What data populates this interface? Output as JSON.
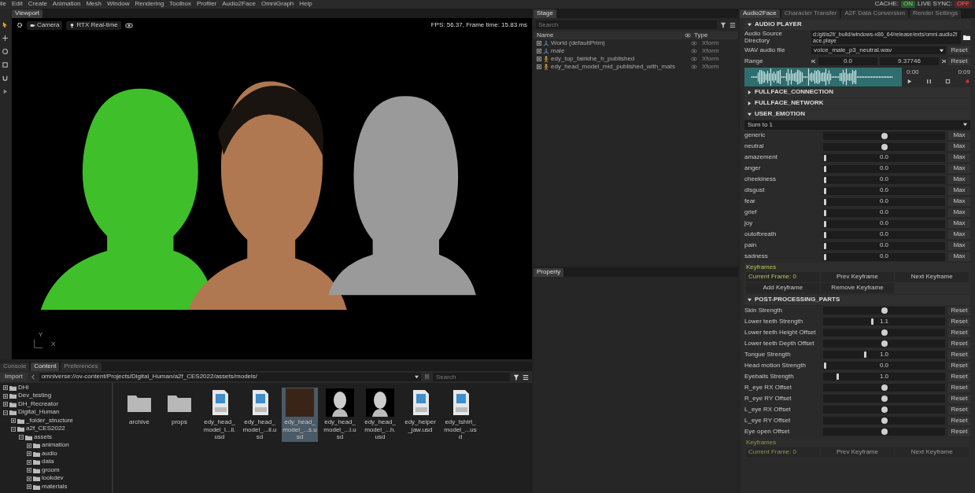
{
  "menu": [
    "ile",
    "Edit",
    "Create",
    "Animation",
    "Mesh",
    "Window",
    "Rendering",
    "Toolbox",
    "Profiler",
    "Audio2Face",
    "OmniGraph",
    "Help"
  ],
  "status": [
    {
      "label": "CACHE:",
      "value": "ON",
      "on": true
    },
    {
      "label": "LIVE SYNC:",
      "value": "OFF",
      "on": false
    }
  ],
  "viewport": {
    "tab": "Viewport",
    "buttons": [
      "Camera",
      "RTX Real-time"
    ],
    "fps": "FPS: 56.37, Frame time: 15.83 ms",
    "axes": [
      "Y",
      "X"
    ]
  },
  "stage": {
    "tab": "Stage",
    "search": {
      "placeholder": "Search"
    },
    "columns": [
      "Name",
      "Type"
    ],
    "rows": [
      {
        "name": "World (defaultPrim)",
        "type": "Xform",
        "kind": "xform"
      },
      {
        "name": "male",
        "type": "Xform",
        "kind": "xform"
      },
      {
        "name": "edy_top_fairkihe_h_published",
        "type": "Xform",
        "kind": "skel"
      },
      {
        "name": "edy_head_model_mid_published_with_mats",
        "type": "Xform",
        "kind": "skel"
      }
    ]
  },
  "property": {
    "tab": "Property"
  },
  "content": {
    "tabs": [
      {
        "label": "Console",
        "selected": false
      },
      {
        "label": "Content",
        "selected": true
      },
      {
        "label": "Preferences",
        "selected": false
      }
    ],
    "import": "Import",
    "path": "omniverse://ov-content/Projects/Digital_Human/a2f_CES2022/assets/models/",
    "search": {
      "placeholder": "Search"
    },
    "tree": [
      {
        "name": "DHI",
        "expanded": false
      },
      {
        "name": "Dev_testing",
        "expanded": false
      },
      {
        "name": "DH_Recreator",
        "expanded": false
      },
      {
        "name": "Digital_Human",
        "expanded": true,
        "children": [
          {
            "name": "_folder_structure",
            "expanded": false
          },
          {
            "name": "a2f_CES2022",
            "expanded": true,
            "children": [
              {
                "name": "assets",
                "expanded": true,
                "children": [
                  {
                    "name": "animation",
                    "expanded": false
                  },
                  {
                    "name": "audio",
                    "expanded": false
                  },
                  {
                    "name": "data",
                    "expanded": false
                  },
                  {
                    "name": "groom",
                    "expanded": false
                  },
                  {
                    "name": "lookdev",
                    "expanded": false
                  },
                  {
                    "name": "materials",
                    "expanded": false
                  }
                ]
              }
            ]
          }
        ]
      }
    ],
    "items": [
      {
        "name": "archive",
        "kind": "folder",
        "selected": false
      },
      {
        "name": "props",
        "kind": "folder",
        "selected": false
      },
      {
        "name": "edy_head_model_l...il.usd",
        "kind": "usd",
        "selected": false
      },
      {
        "name": "edy_head_model_...il.usd",
        "kind": "usd",
        "selected": false
      },
      {
        "name": "edy_head_model_...s.usd",
        "kind": "render",
        "selected": true
      },
      {
        "name": "edy_head_model_...l.usd",
        "kind": "gray",
        "selected": false
      },
      {
        "name": "edy_head_model_...h.usd",
        "kind": "gray",
        "selected": false
      },
      {
        "name": "edy_helper_jaw.usd",
        "kind": "usd",
        "selected": false
      },
      {
        "name": "edy_tshirt_model_...usd",
        "kind": "usd",
        "selected": false
      }
    ]
  },
  "panel": {
    "tabs": [
      {
        "label": "Audio2Face",
        "selected": true
      },
      {
        "label": "Character Transfer",
        "selected": false
      },
      {
        "label": "A2F Data Conversion",
        "selected": false
      },
      {
        "label": "Render Settings",
        "selected": false
      }
    ],
    "audio_player": {
      "title": "AUDIO PLAYER",
      "expanded": true,
      "source_label": "Audio Source Directory",
      "source": "d:/git/a2f/_build/windows-x86_64/release/exts/omni.audio2face.playe",
      "wav_label": "WAV audio file",
      "wav": "voice_male_p3_neutral.wav",
      "range_label": "Range",
      "range_start": "0.0",
      "range_end": "9.37746",
      "wav_reset": "Reset",
      "range_reset": "Reset",
      "time_start": "0:00",
      "time_end": "0:09"
    },
    "collapsed": [
      {
        "title": "FULLFACE_CONNECTION",
        "expanded": false
      },
      {
        "title": "FULLFACE_NETWORK",
        "expanded": false
      }
    ],
    "user_emotion": {
      "title": "USER_EMOTION",
      "expanded": true,
      "mode": "Sum to 1",
      "sliders": [
        {
          "label": "generic",
          "kind": "round",
          "level": 0.5,
          "button": "Max"
        },
        {
          "label": "neutral",
          "kind": "round",
          "level": 0.5,
          "button": "Max"
        },
        {
          "label": "amazement",
          "kind": "value",
          "level": 0,
          "value": "0.0",
          "button": "Max"
        },
        {
          "label": "anger",
          "kind": "value",
          "level": 0,
          "value": "0.0",
          "button": "Max"
        },
        {
          "label": "cheekiness",
          "kind": "value",
          "level": 0,
          "value": "0.0",
          "button": "Max"
        },
        {
          "label": "disgust",
          "kind": "value",
          "level": 0,
          "value": "0.0",
          "button": "Max"
        },
        {
          "label": "fear",
          "kind": "value",
          "level": 0,
          "value": "0.0",
          "button": "Max"
        },
        {
          "label": "grief",
          "kind": "value",
          "level": 0,
          "value": "0.0",
          "button": "Max"
        },
        {
          "label": "joy",
          "kind": "value",
          "level": 0,
          "value": "0.0",
          "button": "Max"
        },
        {
          "label": "outofbreath",
          "kind": "value",
          "level": 0,
          "value": "0.0",
          "button": "Max"
        },
        {
          "label": "pain",
          "kind": "value",
          "level": 0,
          "value": "0.0",
          "button": "Max"
        },
        {
          "label": "sadness",
          "kind": "value",
          "level": 0,
          "value": "0.0",
          "button": "Max"
        }
      ],
      "keyframes": {
        "title": "Keyframes",
        "current": "Current Frame: 0",
        "buttons": [
          "Prev Keyframe",
          "Next Keyframe",
          "Add Keyframe",
          "Remove Keyframe"
        ]
      }
    },
    "post_processing": {
      "title": "POST-PROCESSING_PARTS",
      "expanded": true,
      "sliders": [
        {
          "label": "Skin Strength",
          "kind": "round",
          "level": 0.5,
          "button": "Reset"
        },
        {
          "label": "Lower teeth Strength",
          "kind": "value",
          "level": 0.4,
          "value": "1.1",
          "button": "Reset"
        },
        {
          "label": "Lower teeth Height Offset",
          "kind": "round",
          "level": 0.5,
          "button": "Reset"
        },
        {
          "label": "Lower teeth Depth Offset",
          "kind": "round",
          "level": 0.5,
          "button": "Reset"
        },
        {
          "label": "Tongue Strength",
          "kind": "value",
          "level": 0.34,
          "value": "1.0",
          "button": "Reset"
        },
        {
          "label": "Head motion Strength",
          "kind": "value",
          "level": 0,
          "value": "0.0",
          "button": "Reset"
        },
        {
          "label": "Eyeballs Strength",
          "kind": "value",
          "level": 0.11,
          "value": "1.0",
          "button": "Reset"
        },
        {
          "label": "R_eye RX Offset",
          "kind": "round",
          "level": 0.5,
          "button": "Reset"
        },
        {
          "label": "R_eye RY Offset",
          "kind": "round",
          "level": 0.5,
          "button": "Reset"
        },
        {
          "label": "L_eye RX Offset",
          "kind": "round",
          "level": 0.5,
          "button": "Reset"
        },
        {
          "label": "L_eye RY Offset",
          "kind": "round",
          "level": 0.5,
          "button": "Reset"
        },
        {
          "label": "Eye open Offset",
          "kind": "round",
          "level": 0.5,
          "button": "Reset"
        }
      ],
      "keyframes": {
        "title": "Keyframes",
        "current": "Current Frame: 0",
        "buttons": [
          "Prev Keyframe",
          "Next Keyframe"
        ]
      }
    }
  }
}
